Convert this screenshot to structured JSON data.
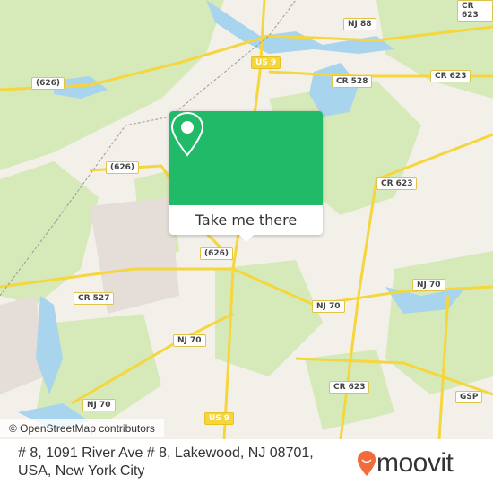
{
  "map": {
    "road_labels": [
      {
        "text": "CR 623",
        "style": "w"
      },
      {
        "text": "NJ 88",
        "style": "w"
      },
      {
        "text": "US 9",
        "style": "y"
      },
      {
        "text": "CR 528",
        "style": "w"
      },
      {
        "text": "CR 623",
        "style": "w"
      },
      {
        "text": "(626)",
        "style": "w"
      },
      {
        "text": "(626)",
        "style": "w"
      },
      {
        "text": "CR 623",
        "style": "w"
      },
      {
        "text": "(626)",
        "style": "w"
      },
      {
        "text": "NJ 70",
        "style": "w"
      },
      {
        "text": "NJ 70",
        "style": "w"
      },
      {
        "text": "CR 527",
        "style": "w"
      },
      {
        "text": "NJ 70",
        "style": "w"
      },
      {
        "text": "CR 623",
        "style": "w"
      },
      {
        "text": "NJ 70",
        "style": "w"
      },
      {
        "text": "US 9",
        "style": "y"
      },
      {
        "text": "GSP",
        "style": "w"
      }
    ],
    "attribution": "© OpenStreetMap contributors",
    "colors": {
      "land": "#f3f0ea",
      "park": "#d6e9b9",
      "water": "#a8d4ee",
      "road": "#f5d63d"
    }
  },
  "popup": {
    "button_label": "Take me there",
    "icon": "map-pin-icon",
    "color": "#21ba69"
  },
  "footer": {
    "address": "# 8, 1091 River Ave # 8, Lakewood, NJ 08701, USA, New York City",
    "brand": "moovit",
    "brand_color": "#f26b3a"
  }
}
